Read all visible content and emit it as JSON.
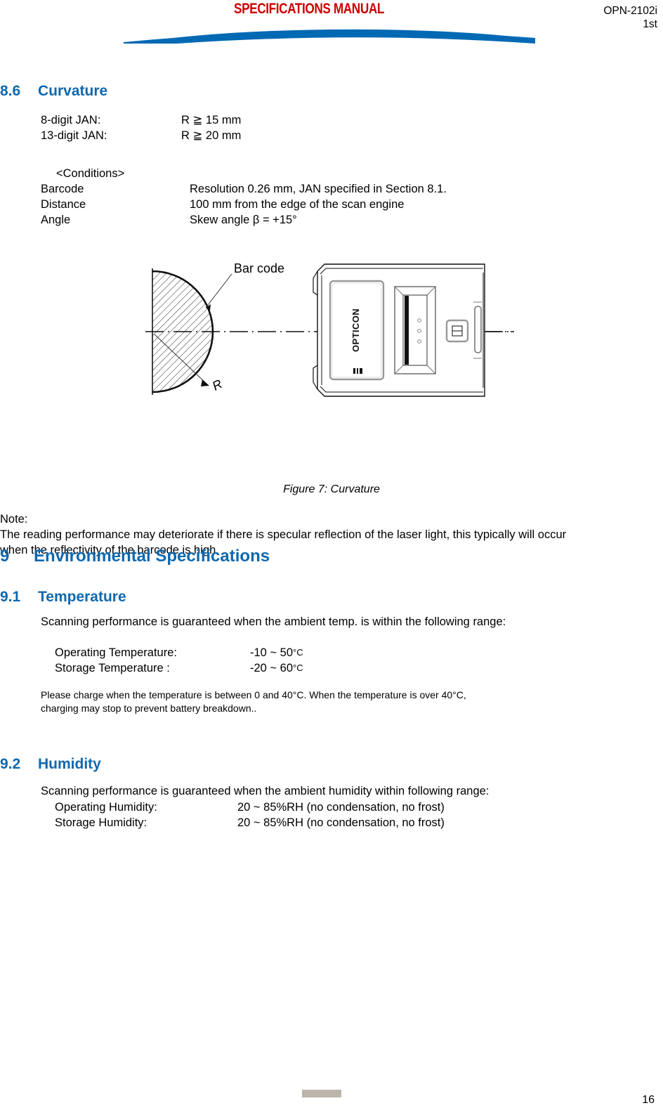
{
  "header": {
    "manual_title": "SPECIFICATIONS MANUAL",
    "model": "OPN-2102i",
    "revision": "1st",
    "accent_red": "#CC0000",
    "accent_blue": "#0069B4"
  },
  "section_8_6": {
    "number": "8.6",
    "title": "Curvature",
    "heading_color": "#1068AE",
    "specs": [
      {
        "label": "8-digit JAN:",
        "value": "R ≧ 15 mm"
      },
      {
        "label": "13-digit JAN:",
        "value": "R ≧ 20 mm"
      }
    ],
    "conditions_title": "<Conditions>",
    "conditions": [
      {
        "label": "Barcode",
        "value": "Resolution 0.26 mm, JAN specified in Section 8.1."
      },
      {
        "label": "Distance",
        "value": "100 mm from the edge of the scan engine"
      },
      {
        "label": "Angle",
        "value": "Skew angle β = +15°"
      }
    ]
  },
  "figure": {
    "barcode_label": "Bar code",
    "radius_label": "R",
    "device_brand": "OPTICON",
    "caption": "Figure 7: Curvature"
  },
  "note": {
    "label": "Note:",
    "line1": "The reading performance may deteriorate if there is specular reflection of the laser light, this typically will occur",
    "line2": "when the reflectivity of the barcode is high."
  },
  "section_9": {
    "number": "9",
    "title": "Environmental Specifications"
  },
  "section_9_1": {
    "number": "9.1",
    "title": "Temperature",
    "intro": "Scanning performance is guaranteed when the ambient temp. is within the following range:",
    "rows": [
      {
        "label": "Operating Temperature:",
        "value": "-10 ~ 50 ",
        "unit": "°C"
      },
      {
        "label": "Storage Temperature :",
        "value": "-20 ~ 60 ",
        "unit": "°C"
      }
    ],
    "note_line1": "Please charge when the temperature is between 0 and 40°C. When the temperature is over 40°C,",
    "note_line2": "charging may stop to prevent battery breakdown.."
  },
  "section_9_2": {
    "number": "9.2",
    "title": "Humidity",
    "intro": "Scanning performance is guaranteed when the ambient humidity within following range:",
    "rows": [
      {
        "label": "Operating Humidity:",
        "value": "20 ~ 85%RH (no condensation, no frost)"
      },
      {
        "label": "Storage Humidity:",
        "value": "20 ~ 85%RH (no condensation, no frost)"
      }
    ]
  },
  "footer": {
    "page_number": "16",
    "bar_color": "#BDB5AA"
  }
}
